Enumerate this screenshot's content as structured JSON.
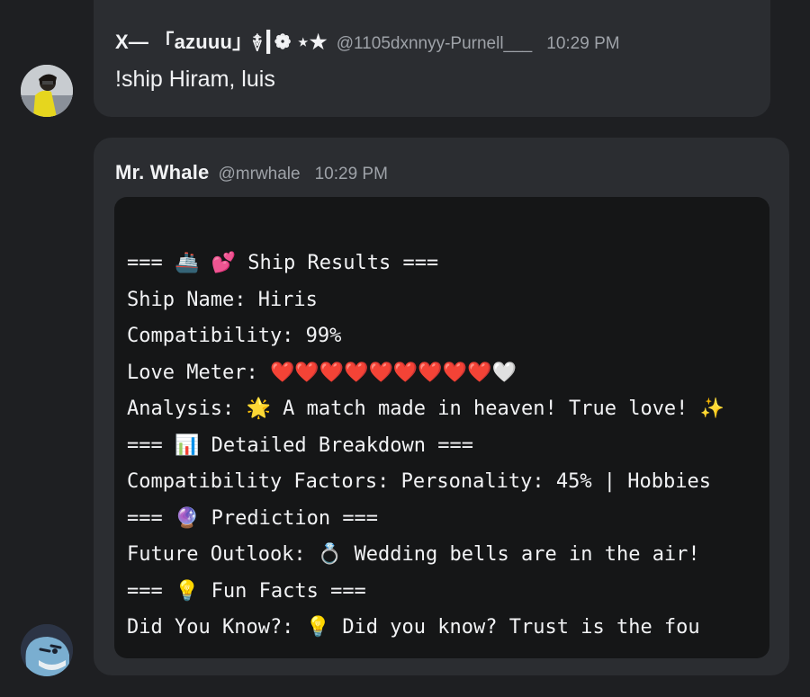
{
  "user_message": {
    "username": "X— 「azuuu」࿈┃❁ ⋆★",
    "handle": "@1105dxnnyy-Purnell___",
    "timestamp": "10:29 PM",
    "text": "!ship Hiram, luis"
  },
  "bot_message": {
    "username": "Mr. Whale",
    "handle": "@mrwhale",
    "timestamp": "10:29 PM",
    "lines": [
      "=== 🚢 💕 Ship Results ===",
      "Ship Name: Hiris",
      "Compatibility: 99%",
      "Love Meter: ❤️❤️❤️❤️❤️❤️❤️❤️❤️🤍",
      "Analysis: 🌟 A match made in heaven! True love! ✨",
      "=== 📊 Detailed Breakdown ===",
      "Compatibility Factors: Personality: 45% | Hobbies",
      "=== 🔮 Prediction ===",
      "Future Outlook: 💍 Wedding bells are in the air!",
      "=== 💡 Fun Facts ===",
      "Did You Know?: 💡 Did you know? Trust is the fou"
    ]
  },
  "colors": {
    "background": "#1e1f22",
    "card": "#2b2d31",
    "codeblock": "#151617",
    "muted_text": "#9ea2a8"
  },
  "icons": {
    "user_avatar": "user-avatar-photo",
    "bot_avatar": "whale-avatar"
  }
}
